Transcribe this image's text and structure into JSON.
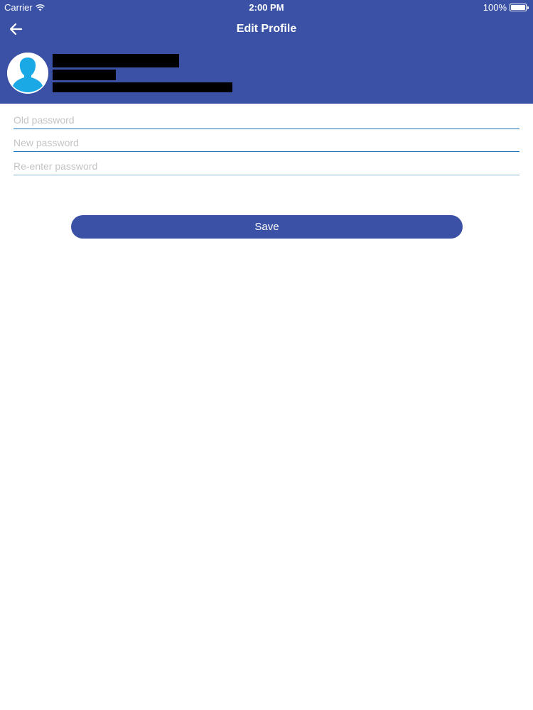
{
  "status_bar": {
    "carrier": "Carrier",
    "time": "2:00 PM",
    "battery": "100%",
    "battery_level": 1.0,
    "wifi_icon": "wifi-icon"
  },
  "nav": {
    "title": "Edit Profile",
    "back_icon": "arrow-left-icon"
  },
  "profile": {
    "avatar_icon": "user-avatar-icon"
  },
  "form": {
    "old_password": {
      "placeholder": "Old password",
      "value": ""
    },
    "new_password": {
      "placeholder": "New password",
      "value": ""
    },
    "reenter_password": {
      "placeholder": "Re-enter password",
      "value": ""
    }
  },
  "actions": {
    "save_label": "Save"
  },
  "colors": {
    "primary": "#3b51a5",
    "field_underline": "#1b75bc",
    "avatar_accent": "#1ba9e6"
  }
}
